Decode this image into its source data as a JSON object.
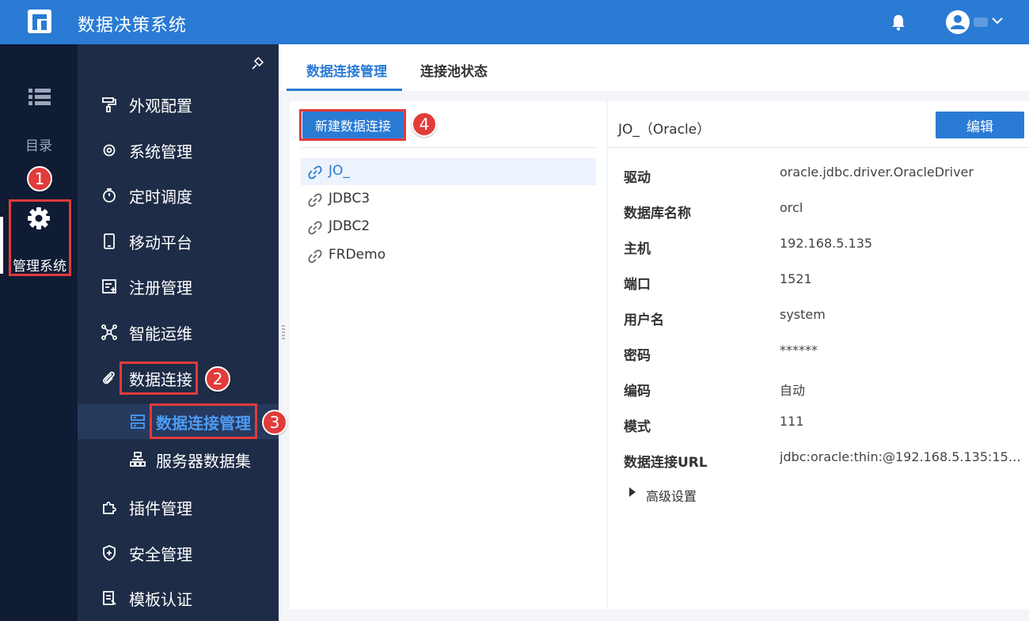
{
  "app": {
    "title": "数据决策系统"
  },
  "rail": {
    "catalog_label": "目录",
    "management_label": "管理系统"
  },
  "nav": {
    "items": [
      {
        "label": "外观配置",
        "icon": "paint-roller-icon"
      },
      {
        "label": "系统管理",
        "icon": "gear-icon"
      },
      {
        "label": "定时调度",
        "icon": "timer-icon"
      },
      {
        "label": "移动平台",
        "icon": "mobile-icon"
      },
      {
        "label": "注册管理",
        "icon": "register-icon"
      },
      {
        "label": "智能运维",
        "icon": "network-icon"
      },
      {
        "label": "数据连接",
        "icon": "paperclip-icon"
      },
      {
        "label": "插件管理",
        "icon": "puzzle-icon"
      },
      {
        "label": "安全管理",
        "icon": "shield-icon"
      },
      {
        "label": "模板认证",
        "icon": "document-icon"
      }
    ],
    "sub_items": [
      {
        "label": "数据连接管理",
        "icon": "db-connection-icon"
      },
      {
        "label": "服务器数据集",
        "icon": "dataset-icon"
      }
    ]
  },
  "tabs": [
    {
      "label": "数据连接管理"
    },
    {
      "label": "连接池状态"
    }
  ],
  "list": {
    "new_button": "新建数据连接",
    "connections": [
      "JO_",
      "JDBC3",
      "JDBC2",
      "FRDemo"
    ]
  },
  "detail": {
    "title": "JO_（Oracle）",
    "edit_button": "编辑",
    "properties": [
      {
        "key": "驱动",
        "value": "oracle.jdbc.driver.OracleDriver"
      },
      {
        "key": "数据库名称",
        "value": "orcl"
      },
      {
        "key": "主机",
        "value": "192.168.5.135"
      },
      {
        "key": "端口",
        "value": "1521"
      },
      {
        "key": "用户名",
        "value": "system"
      },
      {
        "key": "密码",
        "value": "******"
      },
      {
        "key": "编码",
        "value": "自动"
      },
      {
        "key": "模式",
        "value": "111"
      },
      {
        "key": "数据连接URL",
        "value": "jdbc:oracle:thin:@192.168.5.135:1521:…"
      }
    ],
    "advanced_label": "高级设置"
  },
  "annotations": [
    "1",
    "2",
    "3",
    "4"
  ],
  "colors": {
    "accent": "#2a7bd4",
    "rail": "#0f1c33",
    "nav": "#1e2c47",
    "annotation": "#e23b3b"
  }
}
